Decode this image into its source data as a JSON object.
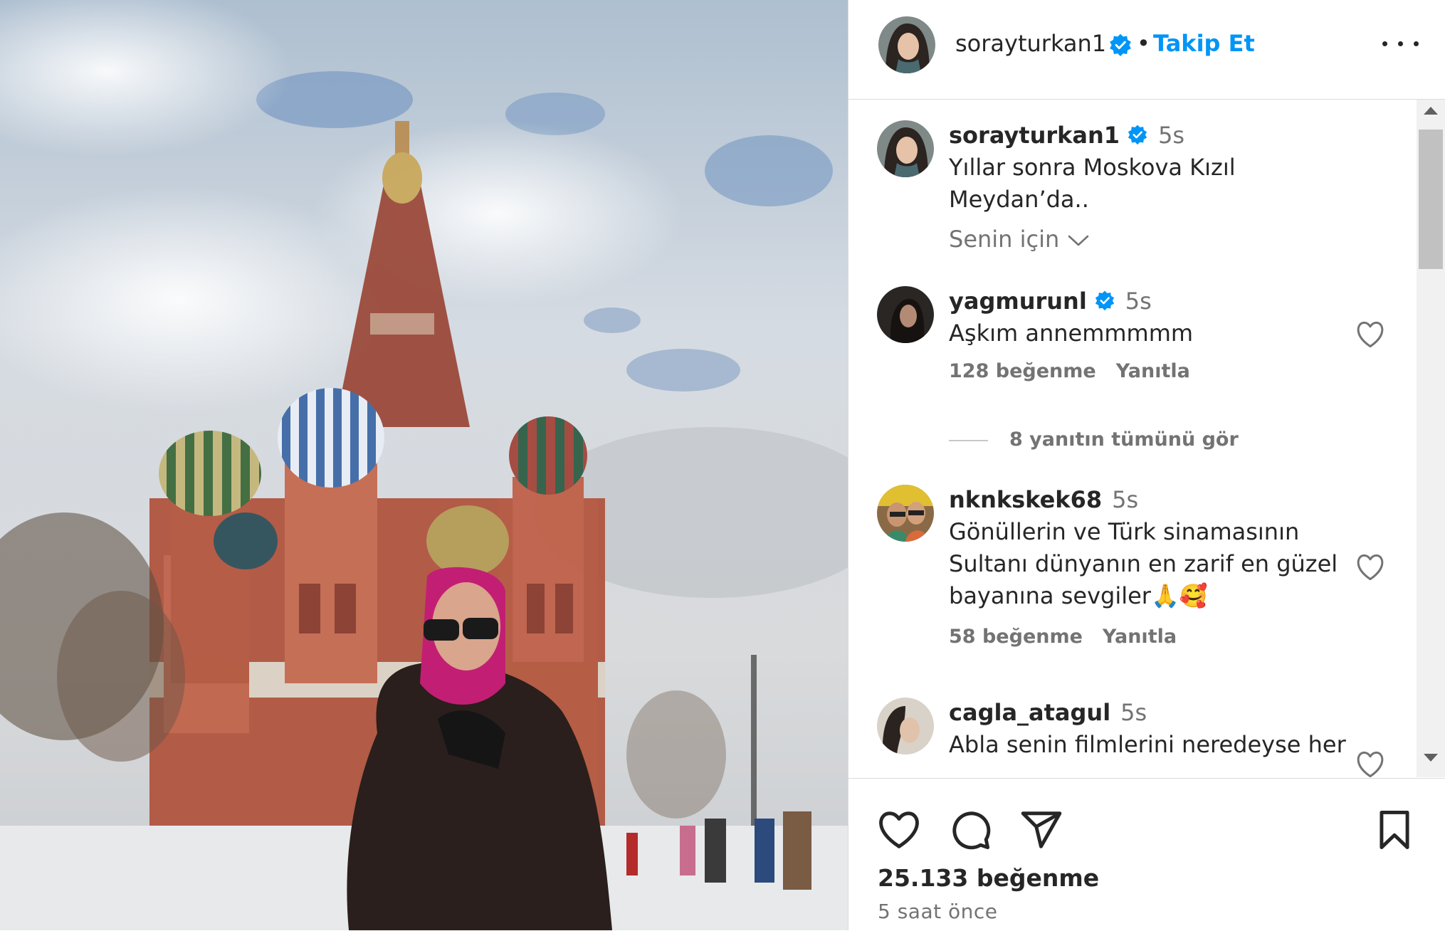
{
  "post": {
    "author": "sorayturkan1",
    "verified": true,
    "follow_label": "Takip Et",
    "separator": "•",
    "photo_alt": "Woman in pink headscarf and dark fur coat in front of St. Basil's Cathedral, Red Square"
  },
  "caption": {
    "username": "sorayturkan1",
    "time": "5s",
    "text": "Yıllar sonra Moskova Kızıl Meydan’da.."
  },
  "sort": {
    "label": "Senin için"
  },
  "comments": [
    {
      "username": "yagmurunl",
      "verified": true,
      "time": "5s",
      "text": "Aşkım annemmmmm",
      "likes": "128 beğenme",
      "reply": "Yanıtla"
    },
    {
      "username": "nknkskek68",
      "verified": false,
      "time": "5s",
      "text": "Gönüllerin ve Türk sinamasının Sultanı dünyanın en zarif en güzel bayanına sevgiler🙏🥰",
      "likes": "58 beğenme",
      "reply": "Yanıtla"
    },
    {
      "username": "cagla_atagul",
      "verified": false,
      "time": "5s",
      "text": "Abla senin filmlerini neredeyse her"
    }
  ],
  "view_replies": "8 yanıtın tümünü gör",
  "footer": {
    "likes": "25.133 beğenme",
    "posted": "5 saat önce"
  },
  "colors": {
    "accent": "#0095f6",
    "verified": "#0095f6",
    "secondary_text": "#737373",
    "divider": "#dbdbdb"
  },
  "icons": [
    "more-icon",
    "verified-badge-icon",
    "chevron-down-icon",
    "heart-icon",
    "comment-icon",
    "share-icon",
    "bookmark-icon"
  ]
}
